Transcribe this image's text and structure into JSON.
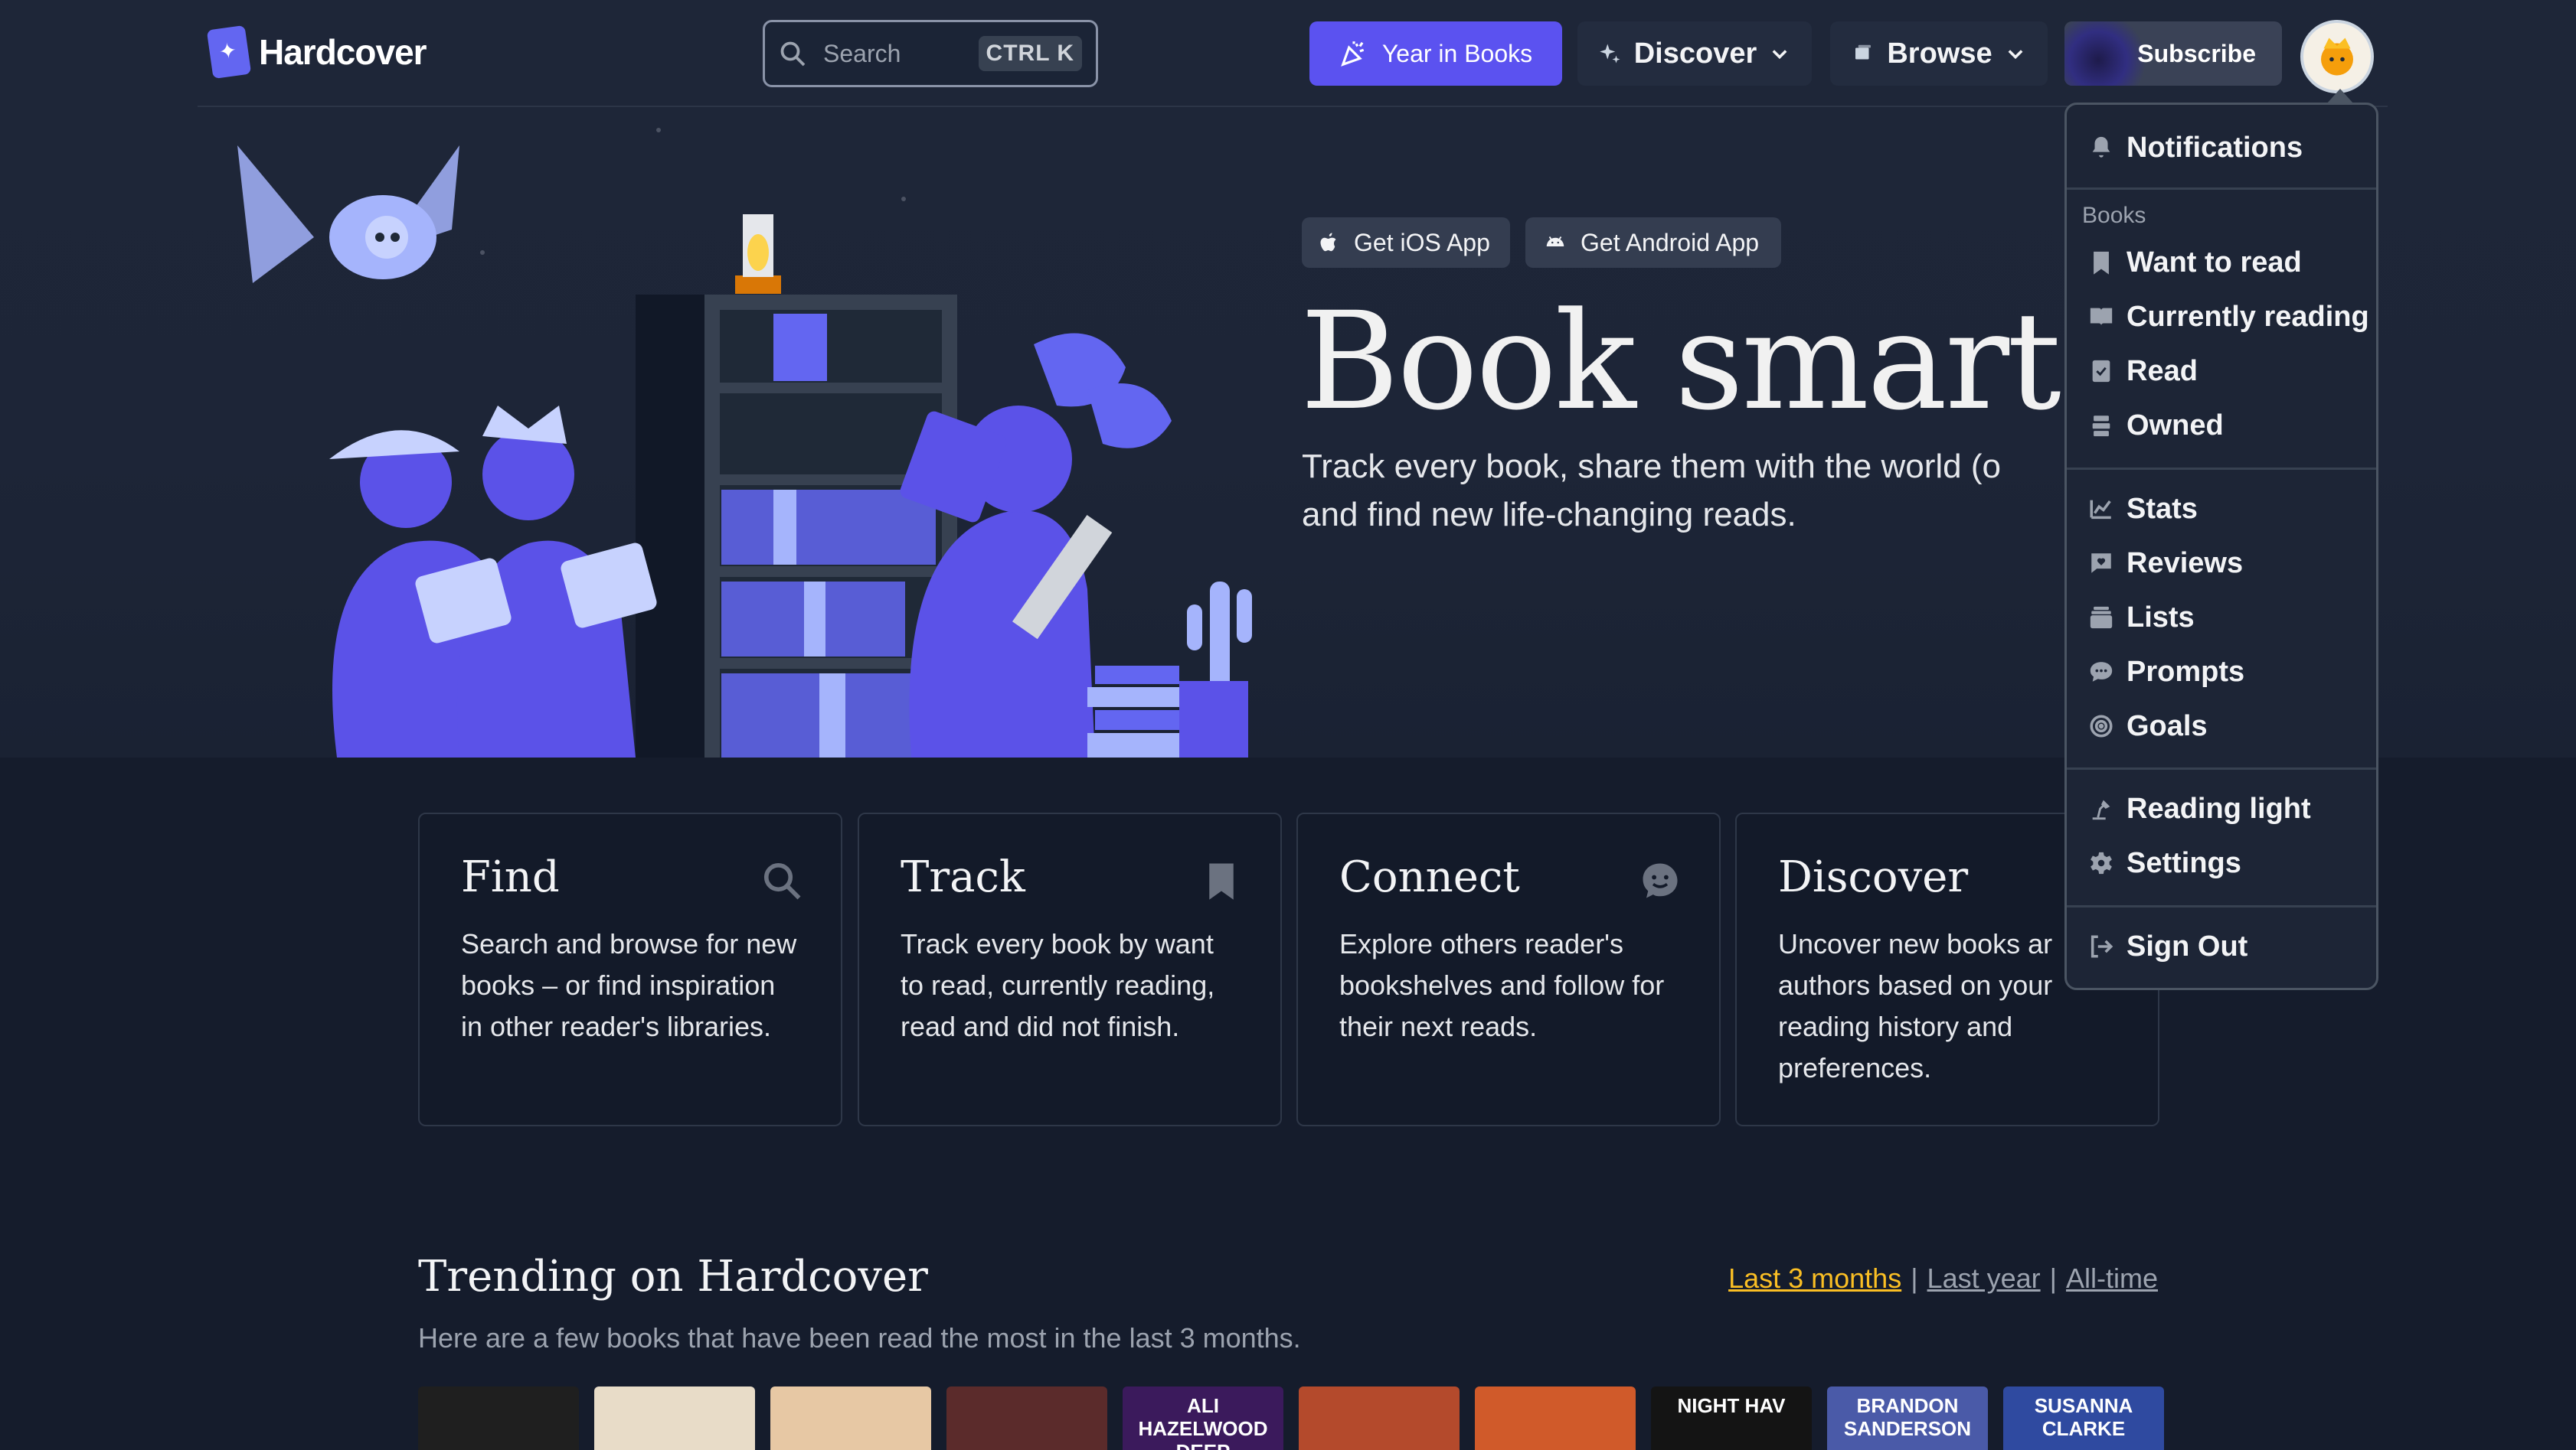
{
  "brand": {
    "name": "Hardcover"
  },
  "header": {
    "search": {
      "placeholder": "Search",
      "shortcut": "CTRL K"
    },
    "year_in_books": "Year in Books",
    "discover": "Discover",
    "browse": "Browse",
    "subscribe": "Subscribe"
  },
  "hero": {
    "ios_button": "Get iOS App",
    "android_button": "Get Android App",
    "title": "Book smart.",
    "subtitle": "Track every book, share them with the world (o",
    "subtitle_line2": "and find new life-changing reads."
  },
  "features": [
    {
      "title": "Find",
      "text": "Search and browse for new books – or find inspiration in other reader's libraries.",
      "icon": "search-icon"
    },
    {
      "title": "Track",
      "text": "Track every book by want to read, currently reading, read and did not finish.",
      "icon": "bookmark-icon"
    },
    {
      "title": "Connect",
      "text": "Explore others reader's bookshelves and follow for their next reads.",
      "icon": "chat-smile-icon"
    },
    {
      "title": "Discover",
      "text": "Uncover new books ar authors based on your reading history and preferences.",
      "icon": "sparkle-icon"
    }
  ],
  "trending": {
    "title": "Trending on Hardcover",
    "subtitle": "Here are a few books that have been read the most in the last 3 months.",
    "filters": [
      {
        "label": "Last 3 months",
        "active": true
      },
      {
        "label": "Last year",
        "active": false
      },
      {
        "label": "All-time",
        "active": false
      }
    ],
    "covers": [
      {
        "color": "#1f1f1f",
        "text": ""
      },
      {
        "color": "#e8dcc8",
        "text": ""
      },
      {
        "color": "#e7c8a4",
        "text": ""
      },
      {
        "color": "#5b2b2b",
        "text": ""
      },
      {
        "color": "#3b1a5c",
        "text": "ALI HAZELWOOD DEEP"
      },
      {
        "color": "#b44a2c",
        "text": ""
      },
      {
        "color": "#d05a2a",
        "text": ""
      },
      {
        "color": "#141414",
        "text": "NIGHT HAV"
      },
      {
        "color": "#4a5aa8",
        "text": "BRANDON SANDERSON"
      },
      {
        "color": "#2f4aa0",
        "text": "SUSANNA CLARKE"
      }
    ]
  },
  "user_menu": {
    "notifications": "Notifications",
    "books_label": "Books",
    "want_to_read": "Want to read",
    "currently_reading": "Currently reading",
    "read": "Read",
    "owned": "Owned",
    "stats": "Stats",
    "reviews": "Reviews",
    "lists": "Lists",
    "prompts": "Prompts",
    "goals": "Goals",
    "reading_light": "Reading light",
    "settings": "Settings",
    "sign_out": "Sign Out"
  },
  "colors": {
    "accent": "#5b52f0",
    "trend_active": "#fbbf24",
    "illustration": "#5b52e8"
  }
}
